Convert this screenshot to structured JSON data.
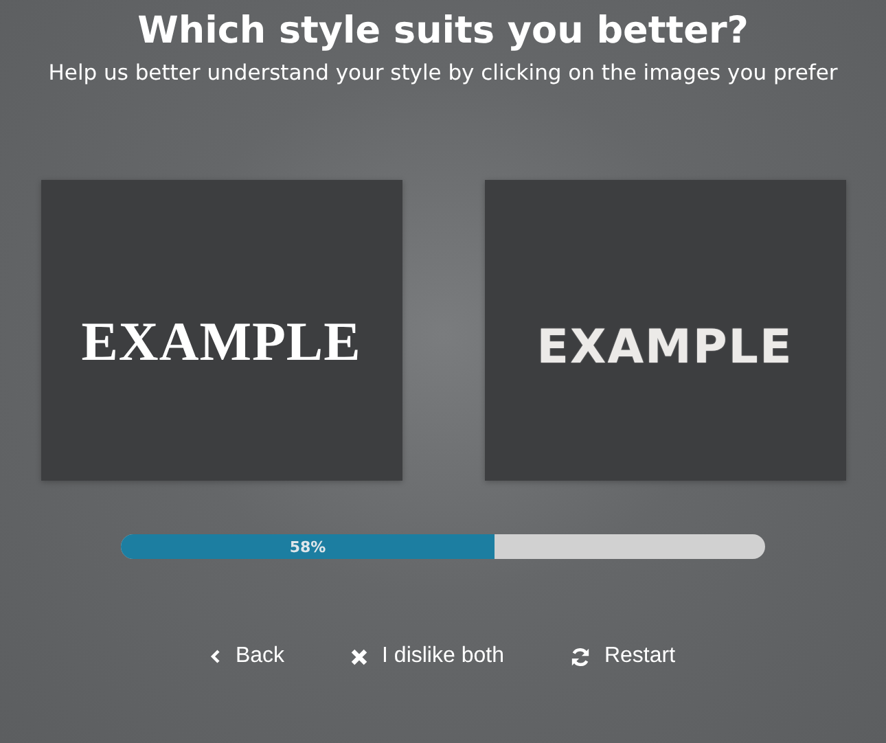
{
  "heading": "Which style suits you better?",
  "subheading": "Help us better understand your style by clicking on the images you prefer",
  "options": [
    {
      "kind": "serif",
      "text": "EXAMPLE"
    },
    {
      "kind": "distressed",
      "text": "EXAMPLE"
    }
  ],
  "progress": {
    "level": 0.58,
    "label": "58%"
  },
  "actions": [
    {
      "kind": "back",
      "label": "Back"
    },
    {
      "kind": "dislike",
      "label": "I dislike both"
    },
    {
      "kind": "restart",
      "label": "Restart"
    }
  ]
}
